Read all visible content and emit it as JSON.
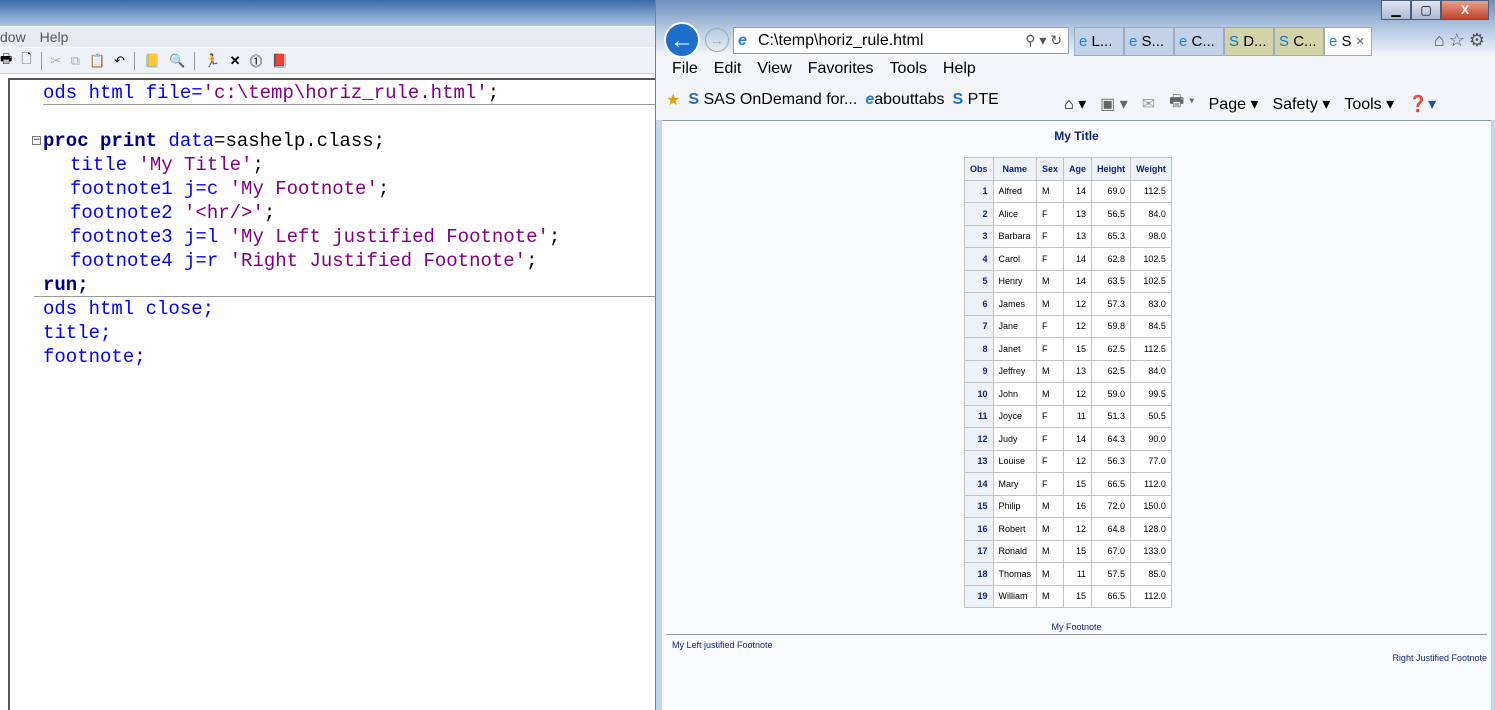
{
  "sas": {
    "menu": [
      "dow",
      "Help"
    ],
    "code": {
      "l1a": "ods html file=",
      "l1b": "'c:\\temp\\horiz_rule.html'",
      "l1c": ";",
      "l2a": "proc print",
      "l2b": " data",
      "l2c": "=sashelp.class;",
      "l3a": "title ",
      "l3b": "'My Title'",
      "l3c": ";",
      "l4a": "footnote1 j=c ",
      "l4b": "'My Footnote'",
      "l4c": ";",
      "l5a": "footnote2 ",
      "l5b": "'<hr/>'",
      "l5c": ";",
      "l6a": "footnote3 j=l ",
      "l6b": "'My Left justified Footnote'",
      "l6c": ";",
      "l7a": "footnote4 j=r ",
      "l7b": "'Right Justified Footnote'",
      "l7c": ";",
      "l8": "run;",
      "l9": "ods html close;",
      "l10": "title;",
      "l11": "footnote;"
    }
  },
  "ie": {
    "address": "C:\\temp\\horiz_rule.html",
    "tabs": [
      "L...",
      "S...",
      "C...",
      "D...",
      "C...",
      "S"
    ],
    "menu": [
      "File",
      "Edit",
      "View",
      "Favorites",
      "Tools",
      "Help"
    ],
    "favorites": [
      "SAS OnDemand for...",
      "abouttabs",
      "PTE"
    ],
    "commands": [
      "Page",
      "Safety",
      "Tools"
    ],
    "page": {
      "title": "My Title",
      "columns": [
        "Obs",
        "Name",
        "Sex",
        "Age",
        "Height",
        "Weight"
      ],
      "rows": [
        [
          "1",
          "Alfred",
          "M",
          "14",
          "69.0",
          "112.5"
        ],
        [
          "2",
          "Alice",
          "F",
          "13",
          "56.5",
          "84.0"
        ],
        [
          "3",
          "Barbara",
          "F",
          "13",
          "65.3",
          "98.0"
        ],
        [
          "4",
          "Carol",
          "F",
          "14",
          "62.8",
          "102.5"
        ],
        [
          "5",
          "Henry",
          "M",
          "14",
          "63.5",
          "102.5"
        ],
        [
          "6",
          "James",
          "M",
          "12",
          "57.3",
          "83.0"
        ],
        [
          "7",
          "Jane",
          "F",
          "12",
          "59.8",
          "84.5"
        ],
        [
          "8",
          "Janet",
          "F",
          "15",
          "62.5",
          "112.5"
        ],
        [
          "9",
          "Jeffrey",
          "M",
          "13",
          "62.5",
          "84.0"
        ],
        [
          "10",
          "John",
          "M",
          "12",
          "59.0",
          "99.5"
        ],
        [
          "11",
          "Joyce",
          "F",
          "11",
          "51.3",
          "50.5"
        ],
        [
          "12",
          "Judy",
          "F",
          "14",
          "64.3",
          "90.0"
        ],
        [
          "13",
          "Louise",
          "F",
          "12",
          "56.3",
          "77.0"
        ],
        [
          "14",
          "Mary",
          "F",
          "15",
          "66.5",
          "112.0"
        ],
        [
          "15",
          "Philip",
          "M",
          "16",
          "72.0",
          "150.0"
        ],
        [
          "16",
          "Robert",
          "M",
          "12",
          "64.8",
          "128.0"
        ],
        [
          "17",
          "Ronald",
          "M",
          "15",
          "67.0",
          "133.0"
        ],
        [
          "18",
          "Thomas",
          "M",
          "11",
          "57.5",
          "85.0"
        ],
        [
          "19",
          "William",
          "M",
          "15",
          "66.5",
          "112.0"
        ]
      ],
      "footnote1": "My Footnote",
      "footnote3": "My Left justified Footnote",
      "footnote4": "Right Justified Footnote"
    }
  }
}
